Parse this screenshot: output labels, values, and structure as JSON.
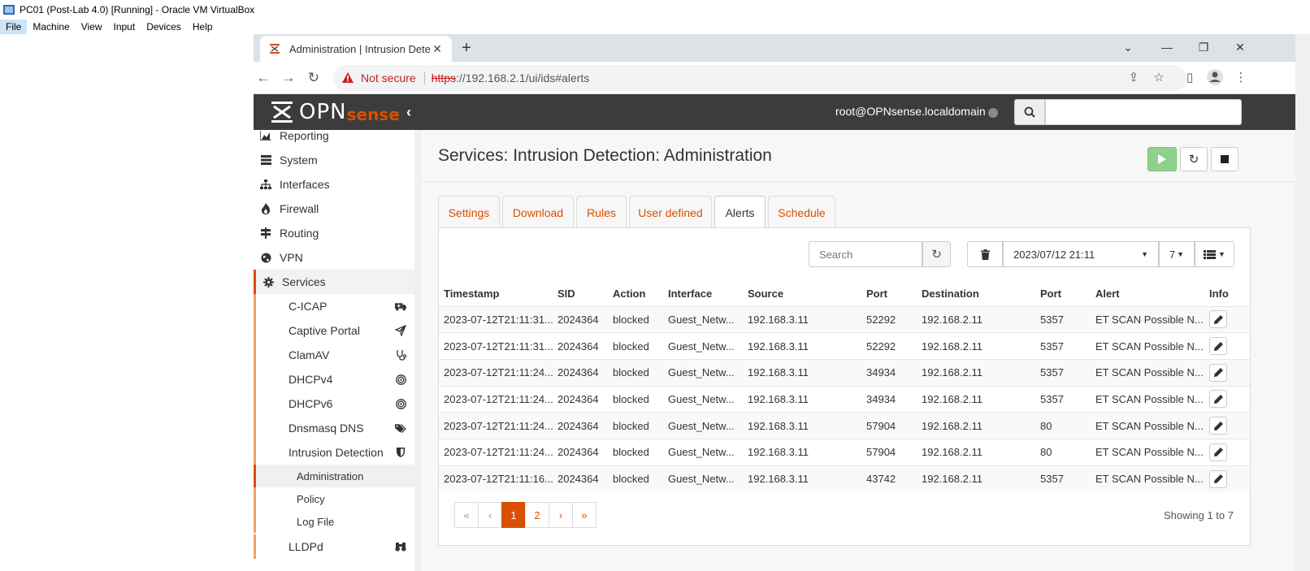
{
  "vbox": {
    "title": "PC01 (Post-Lab 4.0) [Running] - Oracle VM VirtualBox",
    "menu": [
      "File",
      "Machine",
      "View",
      "Input",
      "Devices",
      "Help"
    ]
  },
  "browser": {
    "tab_title": "Administration | Intrusion Detecti",
    "not_secure": "Not secure",
    "url_scheme": "https",
    "url_rest": "://192.168.2.1/ui/ids#alerts"
  },
  "header": {
    "logo_opn": "OPN",
    "logo_sense": "sense",
    "user": "root@OPNsense.localdomain"
  },
  "sidebar": {
    "items": [
      "Reporting",
      "System",
      "Interfaces",
      "Firewall",
      "Routing",
      "VPN",
      "Services"
    ],
    "services_sub": [
      "C-ICAP",
      "Captive Portal",
      "ClamAV",
      "DHCPv4",
      "DHCPv6",
      "Dnsmasq DNS",
      "Intrusion Detection"
    ],
    "ids_sub": [
      "Administration",
      "Policy",
      "Log File"
    ],
    "next_sub": "LLDPd"
  },
  "page": {
    "title": "Services: Intrusion Detection: Administration",
    "tabs": [
      "Settings",
      "Download",
      "Rules",
      "User defined",
      "Alerts",
      "Schedule"
    ]
  },
  "alerts": {
    "search_placeholder": "Search",
    "date": "2023/07/12 21:11",
    "count": "7",
    "columns": [
      "Timestamp",
      "SID",
      "Action",
      "Interface",
      "Source",
      "Port",
      "Destination",
      "Port",
      "Alert",
      "Info"
    ],
    "rows": [
      [
        "2023-07-12T21:11:31...",
        "2024364",
        "blocked",
        "Guest_Netw...",
        "192.168.3.11",
        "52292",
        "192.168.2.11",
        "5357",
        "ET SCAN Possible N..."
      ],
      [
        "2023-07-12T21:11:31...",
        "2024364",
        "blocked",
        "Guest_Netw...",
        "192.168.3.11",
        "52292",
        "192.168.2.11",
        "5357",
        "ET SCAN Possible N..."
      ],
      [
        "2023-07-12T21:11:24...",
        "2024364",
        "blocked",
        "Guest_Netw...",
        "192.168.3.11",
        "34934",
        "192.168.2.11",
        "5357",
        "ET SCAN Possible N..."
      ],
      [
        "2023-07-12T21:11:24...",
        "2024364",
        "blocked",
        "Guest_Netw...",
        "192.168.3.11",
        "34934",
        "192.168.2.11",
        "5357",
        "ET SCAN Possible N..."
      ],
      [
        "2023-07-12T21:11:24...",
        "2024364",
        "blocked",
        "Guest_Netw...",
        "192.168.3.11",
        "57904",
        "192.168.2.11",
        "80",
        "ET SCAN Possible N..."
      ],
      [
        "2023-07-12T21:11:24...",
        "2024364",
        "blocked",
        "Guest_Netw...",
        "192.168.3.11",
        "57904",
        "192.168.2.11",
        "80",
        "ET SCAN Possible N..."
      ],
      [
        "2023-07-12T21:11:16...",
        "2024364",
        "blocked",
        "Guest_Netw...",
        "192.168.3.11",
        "43742",
        "192.168.2.11",
        "5357",
        "ET SCAN Possible N..."
      ]
    ],
    "pager": [
      "«",
      "‹",
      "1",
      "2",
      "›",
      "»"
    ],
    "showing": "Showing 1 to 7"
  },
  "colors": {
    "accent": "#d94f00",
    "start_button": "#8ed08e",
    "topbar": "#3c3c3c"
  },
  "icons": [
    "search-icon",
    "refresh-icon",
    "trash-icon",
    "pencil-icon",
    "list-icon",
    "play-icon",
    "stop-icon"
  ]
}
